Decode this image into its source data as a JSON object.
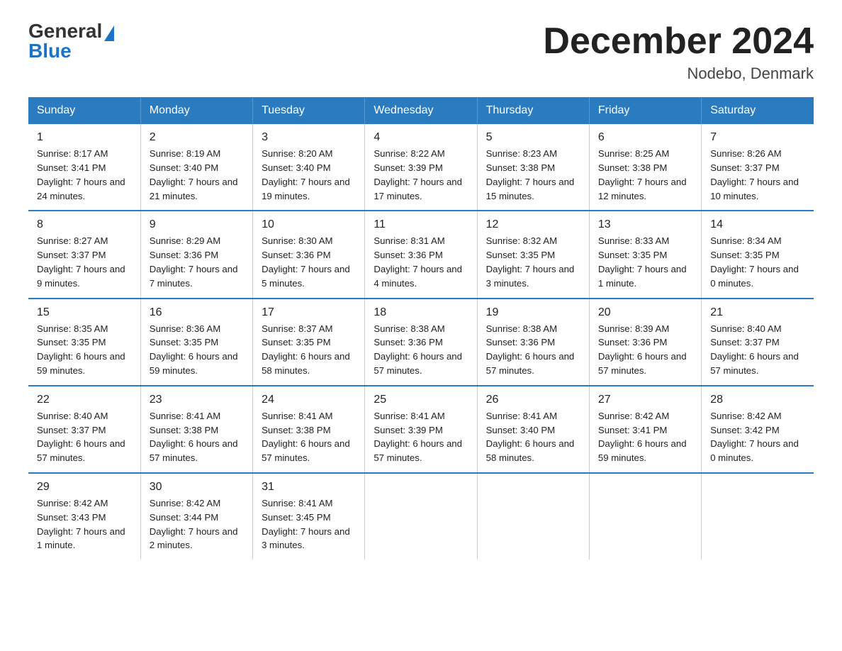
{
  "header": {
    "logo_general": "General",
    "logo_blue": "Blue",
    "month_title": "December 2024",
    "location": "Nodebo, Denmark"
  },
  "days_of_week": [
    "Sunday",
    "Monday",
    "Tuesday",
    "Wednesday",
    "Thursday",
    "Friday",
    "Saturday"
  ],
  "weeks": [
    [
      {
        "day": "1",
        "sunrise": "8:17 AM",
        "sunset": "3:41 PM",
        "daylight": "7 hours and 24 minutes."
      },
      {
        "day": "2",
        "sunrise": "8:19 AM",
        "sunset": "3:40 PM",
        "daylight": "7 hours and 21 minutes."
      },
      {
        "day": "3",
        "sunrise": "8:20 AM",
        "sunset": "3:40 PM",
        "daylight": "7 hours and 19 minutes."
      },
      {
        "day": "4",
        "sunrise": "8:22 AM",
        "sunset": "3:39 PM",
        "daylight": "7 hours and 17 minutes."
      },
      {
        "day": "5",
        "sunrise": "8:23 AM",
        "sunset": "3:38 PM",
        "daylight": "7 hours and 15 minutes."
      },
      {
        "day": "6",
        "sunrise": "8:25 AM",
        "sunset": "3:38 PM",
        "daylight": "7 hours and 12 minutes."
      },
      {
        "day": "7",
        "sunrise": "8:26 AM",
        "sunset": "3:37 PM",
        "daylight": "7 hours and 10 minutes."
      }
    ],
    [
      {
        "day": "8",
        "sunrise": "8:27 AM",
        "sunset": "3:37 PM",
        "daylight": "7 hours and 9 minutes."
      },
      {
        "day": "9",
        "sunrise": "8:29 AM",
        "sunset": "3:36 PM",
        "daylight": "7 hours and 7 minutes."
      },
      {
        "day": "10",
        "sunrise": "8:30 AM",
        "sunset": "3:36 PM",
        "daylight": "7 hours and 5 minutes."
      },
      {
        "day": "11",
        "sunrise": "8:31 AM",
        "sunset": "3:36 PM",
        "daylight": "7 hours and 4 minutes."
      },
      {
        "day": "12",
        "sunrise": "8:32 AM",
        "sunset": "3:35 PM",
        "daylight": "7 hours and 3 minutes."
      },
      {
        "day": "13",
        "sunrise": "8:33 AM",
        "sunset": "3:35 PM",
        "daylight": "7 hours and 1 minute."
      },
      {
        "day": "14",
        "sunrise": "8:34 AM",
        "sunset": "3:35 PM",
        "daylight": "7 hours and 0 minutes."
      }
    ],
    [
      {
        "day": "15",
        "sunrise": "8:35 AM",
        "sunset": "3:35 PM",
        "daylight": "6 hours and 59 minutes."
      },
      {
        "day": "16",
        "sunrise": "8:36 AM",
        "sunset": "3:35 PM",
        "daylight": "6 hours and 59 minutes."
      },
      {
        "day": "17",
        "sunrise": "8:37 AM",
        "sunset": "3:35 PM",
        "daylight": "6 hours and 58 minutes."
      },
      {
        "day": "18",
        "sunrise": "8:38 AM",
        "sunset": "3:36 PM",
        "daylight": "6 hours and 57 minutes."
      },
      {
        "day": "19",
        "sunrise": "8:38 AM",
        "sunset": "3:36 PM",
        "daylight": "6 hours and 57 minutes."
      },
      {
        "day": "20",
        "sunrise": "8:39 AM",
        "sunset": "3:36 PM",
        "daylight": "6 hours and 57 minutes."
      },
      {
        "day": "21",
        "sunrise": "8:40 AM",
        "sunset": "3:37 PM",
        "daylight": "6 hours and 57 minutes."
      }
    ],
    [
      {
        "day": "22",
        "sunrise": "8:40 AM",
        "sunset": "3:37 PM",
        "daylight": "6 hours and 57 minutes."
      },
      {
        "day": "23",
        "sunrise": "8:41 AM",
        "sunset": "3:38 PM",
        "daylight": "6 hours and 57 minutes."
      },
      {
        "day": "24",
        "sunrise": "8:41 AM",
        "sunset": "3:38 PM",
        "daylight": "6 hours and 57 minutes."
      },
      {
        "day": "25",
        "sunrise": "8:41 AM",
        "sunset": "3:39 PM",
        "daylight": "6 hours and 57 minutes."
      },
      {
        "day": "26",
        "sunrise": "8:41 AM",
        "sunset": "3:40 PM",
        "daylight": "6 hours and 58 minutes."
      },
      {
        "day": "27",
        "sunrise": "8:42 AM",
        "sunset": "3:41 PM",
        "daylight": "6 hours and 59 minutes."
      },
      {
        "day": "28",
        "sunrise": "8:42 AM",
        "sunset": "3:42 PM",
        "daylight": "7 hours and 0 minutes."
      }
    ],
    [
      {
        "day": "29",
        "sunrise": "8:42 AM",
        "sunset": "3:43 PM",
        "daylight": "7 hours and 1 minute."
      },
      {
        "day": "30",
        "sunrise": "8:42 AM",
        "sunset": "3:44 PM",
        "daylight": "7 hours and 2 minutes."
      },
      {
        "day": "31",
        "sunrise": "8:41 AM",
        "sunset": "3:45 PM",
        "daylight": "7 hours and 3 minutes."
      },
      null,
      null,
      null,
      null
    ]
  ],
  "labels": {
    "sunrise": "Sunrise:",
    "sunset": "Sunset:",
    "daylight": "Daylight:"
  }
}
